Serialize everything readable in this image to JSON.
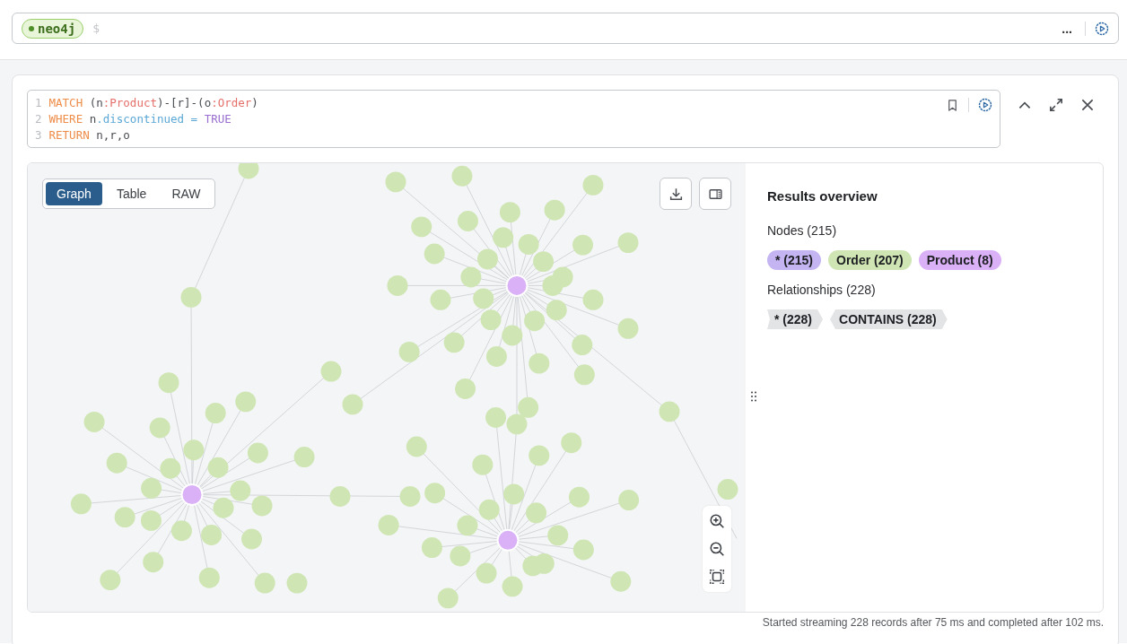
{
  "top_bar": {
    "database": "neo4j",
    "prompt": "$",
    "menu": "..."
  },
  "editor": {
    "lines": [
      {
        "number": "1",
        "tokens": [
          {
            "text": "MATCH",
            "kind": "keyword"
          },
          {
            "text": " (n",
            "kind": "plain"
          },
          {
            "text": ":Product",
            "kind": "label"
          },
          {
            "text": ")-[r]-(o",
            "kind": "plain"
          },
          {
            "text": ":Order",
            "kind": "label"
          },
          {
            "text": ")",
            "kind": "plain"
          }
        ]
      },
      {
        "number": "2",
        "tokens": [
          {
            "text": "WHERE",
            "kind": "keyword"
          },
          {
            "text": " n",
            "kind": "plain"
          },
          {
            "text": ".discontinued",
            "kind": "property"
          },
          {
            "text": " = ",
            "kind": "property"
          },
          {
            "text": "TRUE",
            "kind": "boolean"
          }
        ]
      },
      {
        "number": "3",
        "tokens": [
          {
            "text": "RETURN",
            "kind": "keyword"
          },
          {
            "text": " n,r,o",
            "kind": "plain"
          }
        ]
      }
    ]
  },
  "view_tabs": [
    {
      "label": "Graph",
      "selected": true
    },
    {
      "label": "Table",
      "selected": false
    },
    {
      "label": "RAW",
      "selected": false
    }
  ],
  "overview": {
    "title": "Results overview",
    "nodes_heading": "Nodes (215)",
    "node_labels": [
      {
        "text": "* (215)",
        "color": "#c4b5f2"
      },
      {
        "text": "Order (207)",
        "color": "#cfe6b4"
      },
      {
        "text": "Product (8)",
        "color": "#dab1f7"
      }
    ],
    "relationships_heading": "Relationships (228)",
    "relationship_types": [
      {
        "text": "* (228)",
        "color": "#e3e4e6"
      },
      {
        "text": "CONTAINS (228)",
        "color": "#e3e4e6"
      }
    ]
  },
  "status": "Started streaming 228 records after 75 ms and completed after 102 ms."
}
